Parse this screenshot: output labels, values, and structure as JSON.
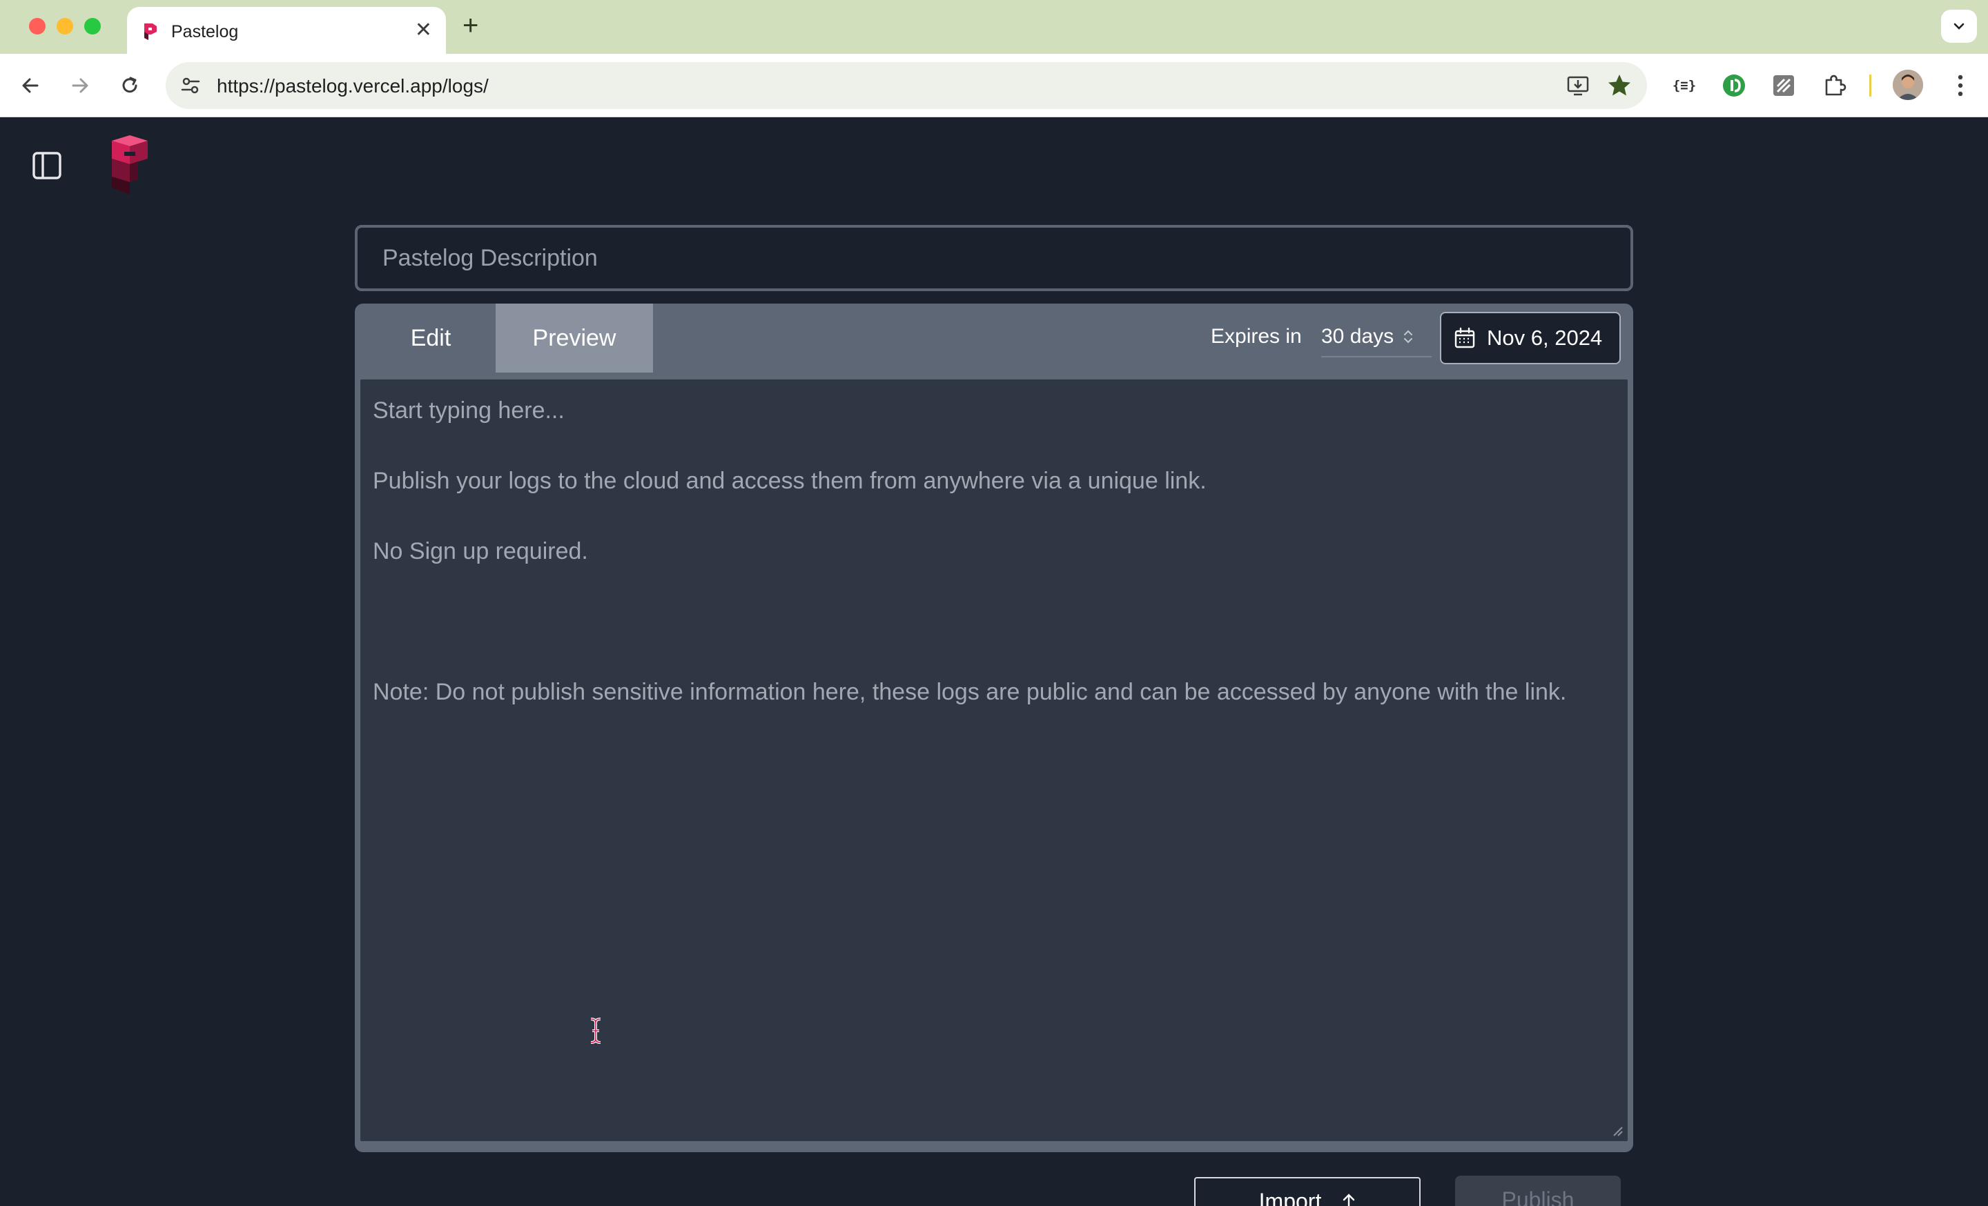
{
  "browser": {
    "tab_title": "Pastelog",
    "url_host": "https://pastelog.vercel.app",
    "url_path": "/logs/",
    "ext_json_label": "{≡}"
  },
  "app": {
    "description_placeholder": "Pastelog Description",
    "tabs": [
      {
        "label": "Edit",
        "active": false
      },
      {
        "label": "Preview",
        "active": true
      }
    ],
    "expires_label": "Expires in",
    "expires_value": "30 days",
    "expiry_date": "Nov 6, 2024",
    "editor_lines": {
      "line1": "Start typing here...",
      "line2": "Publish your logs to the cloud and access them from anywhere via a unique link.",
      "line3": "No Sign up required.",
      "line4": "Note: Do not publish sensitive information here, these logs are public and can be accessed by anyone with the link."
    },
    "import_label": "Import",
    "publish_label": "Publish"
  },
  "colors": {
    "background": "#1b212c",
    "editor_bg": "#2f3744",
    "card_bg": "#5e6776",
    "brand": "#e0245e"
  }
}
